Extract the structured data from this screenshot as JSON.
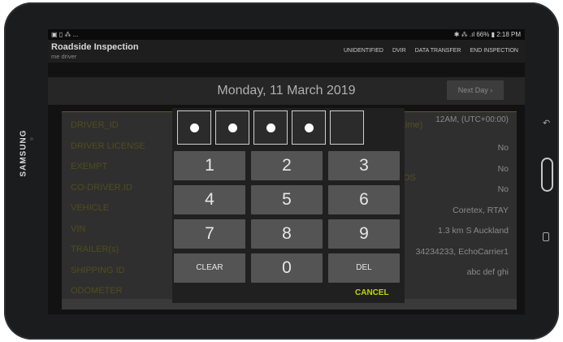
{
  "device": {
    "brand": "SAMSUNG"
  },
  "statusbar": {
    "left": "▣ ▯ ⁂ ...",
    "right": "✱ ⁂ .ıl 66% ▮ 2:18 PM"
  },
  "appbar": {
    "title": "Roadside Inspection",
    "subtitle": "me driver",
    "menu": [
      "UNIDENTIFIED",
      "DVIR",
      "DATA TRANSFER",
      "END INSPECTION"
    ]
  },
  "datebar": {
    "date": "Monday, 11 March 2019",
    "next_label": "Next Day ›"
  },
  "fields": {
    "labels": [
      "DRIVER_ID",
      "DRIVER LICENSE",
      "EXEMPT",
      "CO-DRIVER.ID",
      "VEHICLE",
      "VIN",
      "TRAILER(s)",
      "SHIPPING ID",
      "ODOMETER"
    ],
    "values": {
      "timezone": "12AM, (UTC+00:00)",
      "exempt": "No",
      "row3": "No",
      "row4": "No",
      "vehicle": "Coretex, RTAY",
      "location": "1.3 km S Auckland",
      "shipping": "34234233, EchoCarrier1",
      "odometer": "abc def ghi"
    },
    "mid_fragments": {
      "time": "time)",
      "os": "OS"
    }
  },
  "keypad": {
    "pin_length": 5,
    "filled": 4,
    "keys": [
      "1",
      "2",
      "3",
      "4",
      "5",
      "6",
      "7",
      "8",
      "9",
      "CLEAR",
      "0",
      "DEL"
    ],
    "cancel_label": "CANCEL"
  }
}
